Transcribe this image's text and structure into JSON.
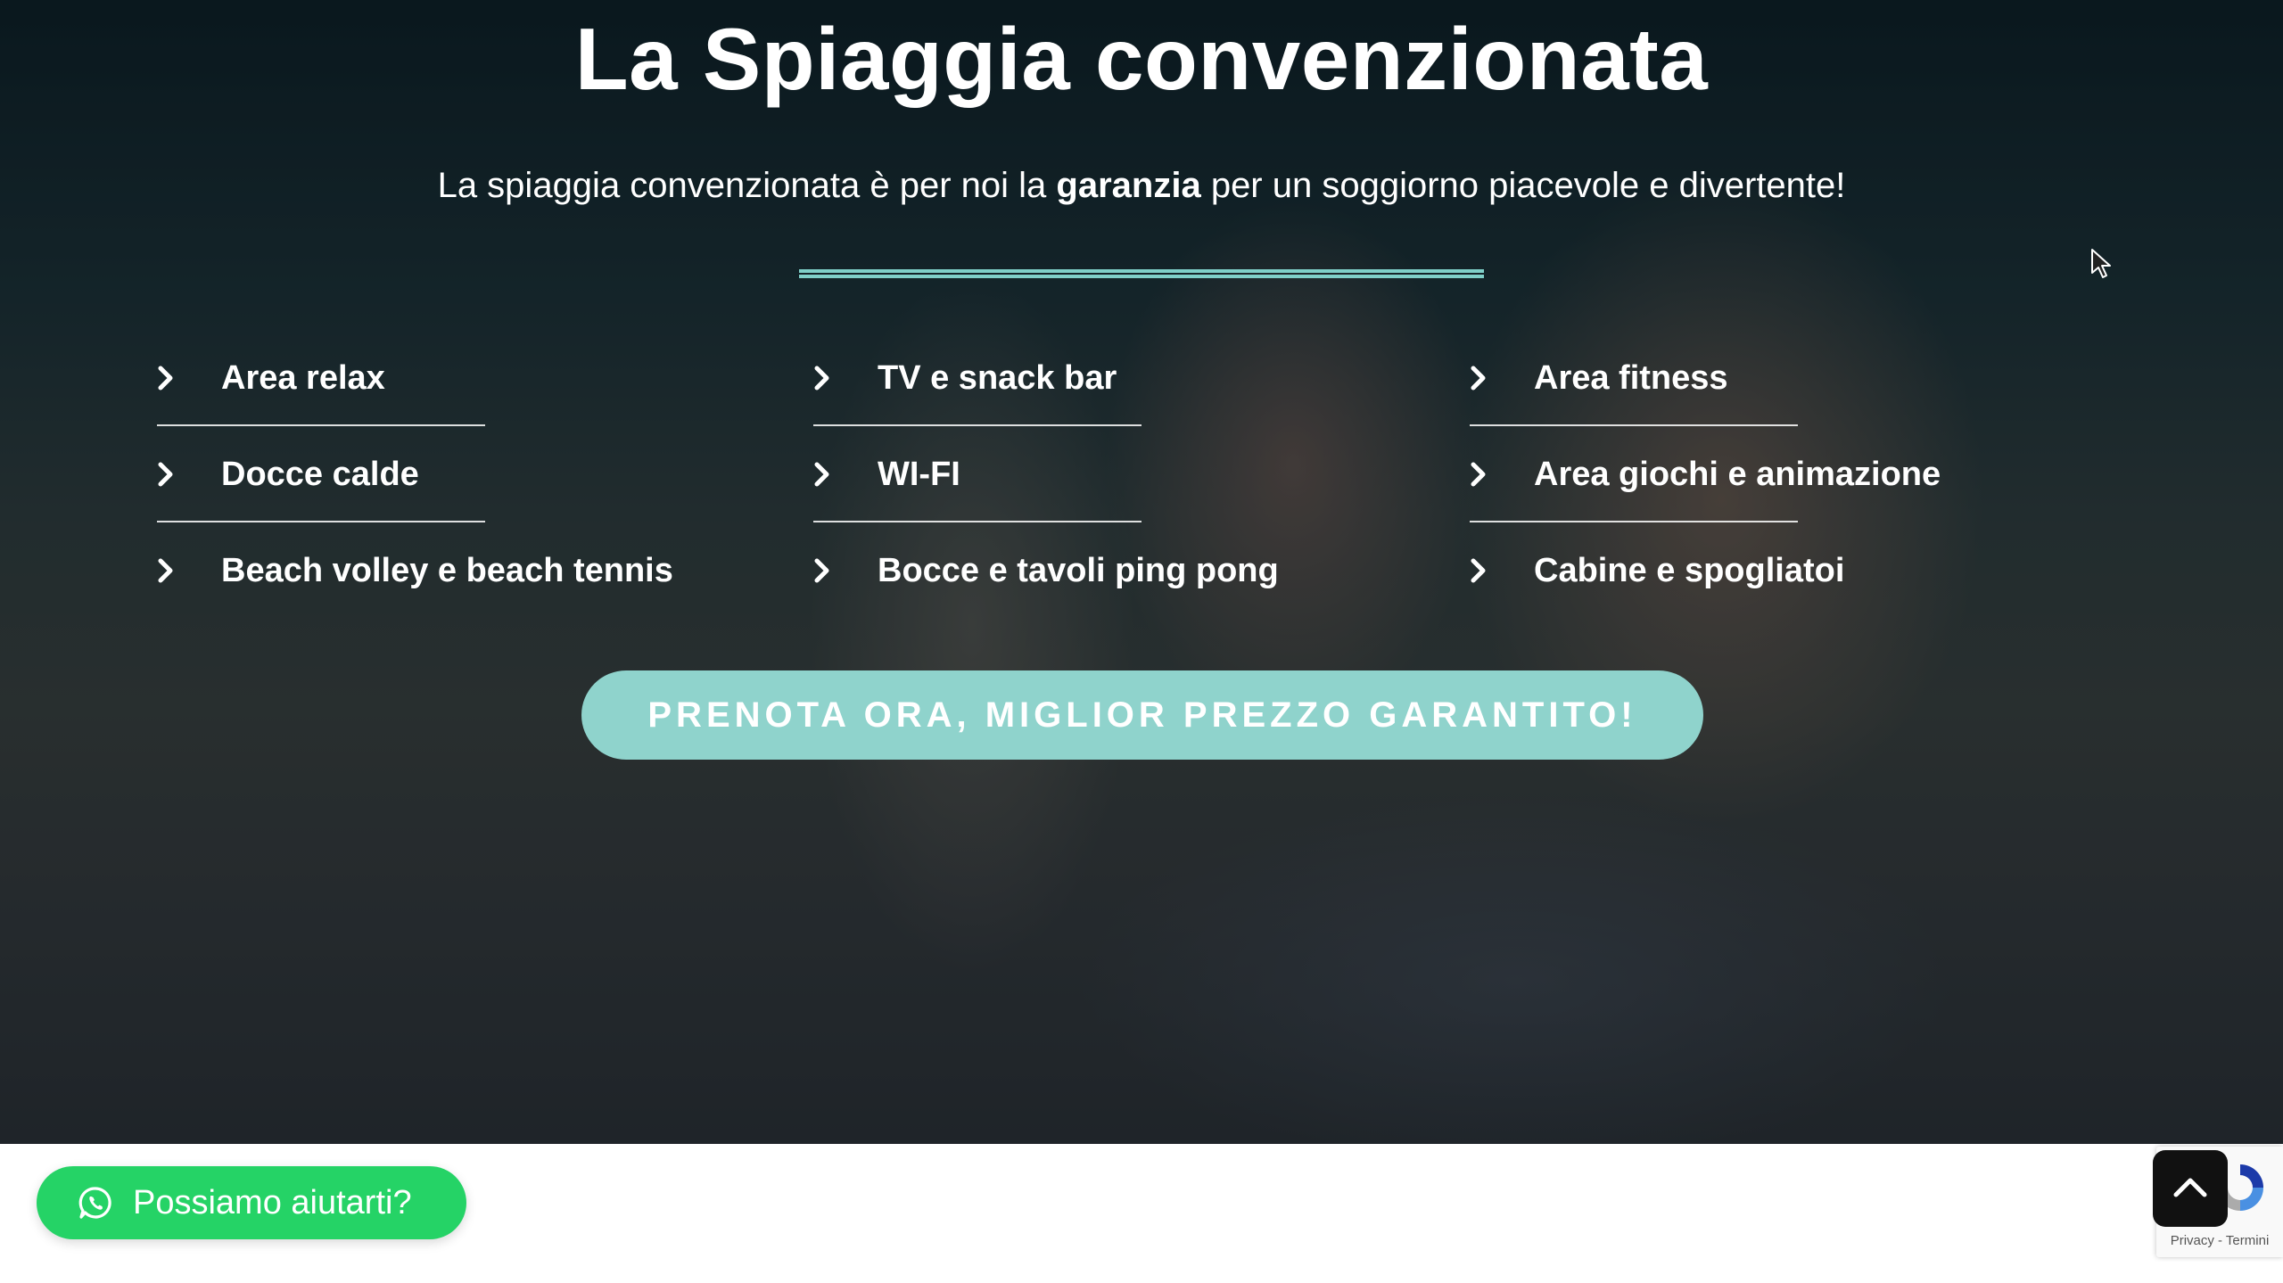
{
  "hero": {
    "title": "La Spiaggia convenzionata",
    "subtitle_before": "La spiaggia convenzionata è per noi la ",
    "subtitle_bold": "garanzia",
    "subtitle_after": " per un soggiorno piacevole e divertente!",
    "accent_color": "#8fd3cc"
  },
  "features": [
    {
      "label": "Area relax",
      "icon": "chevron-right-icon"
    },
    {
      "label": "TV e snack bar",
      "icon": "chevron-right-icon"
    },
    {
      "label": "Area fitness",
      "icon": "chevron-right-icon"
    },
    {
      "label": "Docce calde",
      "icon": "chevron-right-icon"
    },
    {
      "label": "WI-FI",
      "icon": "chevron-right-icon"
    },
    {
      "label": "Area giochi e animazione",
      "icon": "chevron-right-icon"
    },
    {
      "label": "Beach volley e beach tennis",
      "icon": "chevron-right-icon"
    },
    {
      "label": "Bocce e tavoli ping pong",
      "icon": "chevron-right-icon"
    },
    {
      "label": "Cabine e spogliatoi",
      "icon": "chevron-right-icon"
    }
  ],
  "cta": {
    "label": "PRENOTA ORA, MIGLIOR PREZZO GARANTITO!"
  },
  "whatsapp": {
    "label": "Possiamo aiutarti?",
    "icon": "whatsapp-icon",
    "color": "#25d366"
  },
  "recaptcha": {
    "links": "Privacy - Termini"
  },
  "scroll_top": {
    "icon": "chevron-up-icon"
  }
}
